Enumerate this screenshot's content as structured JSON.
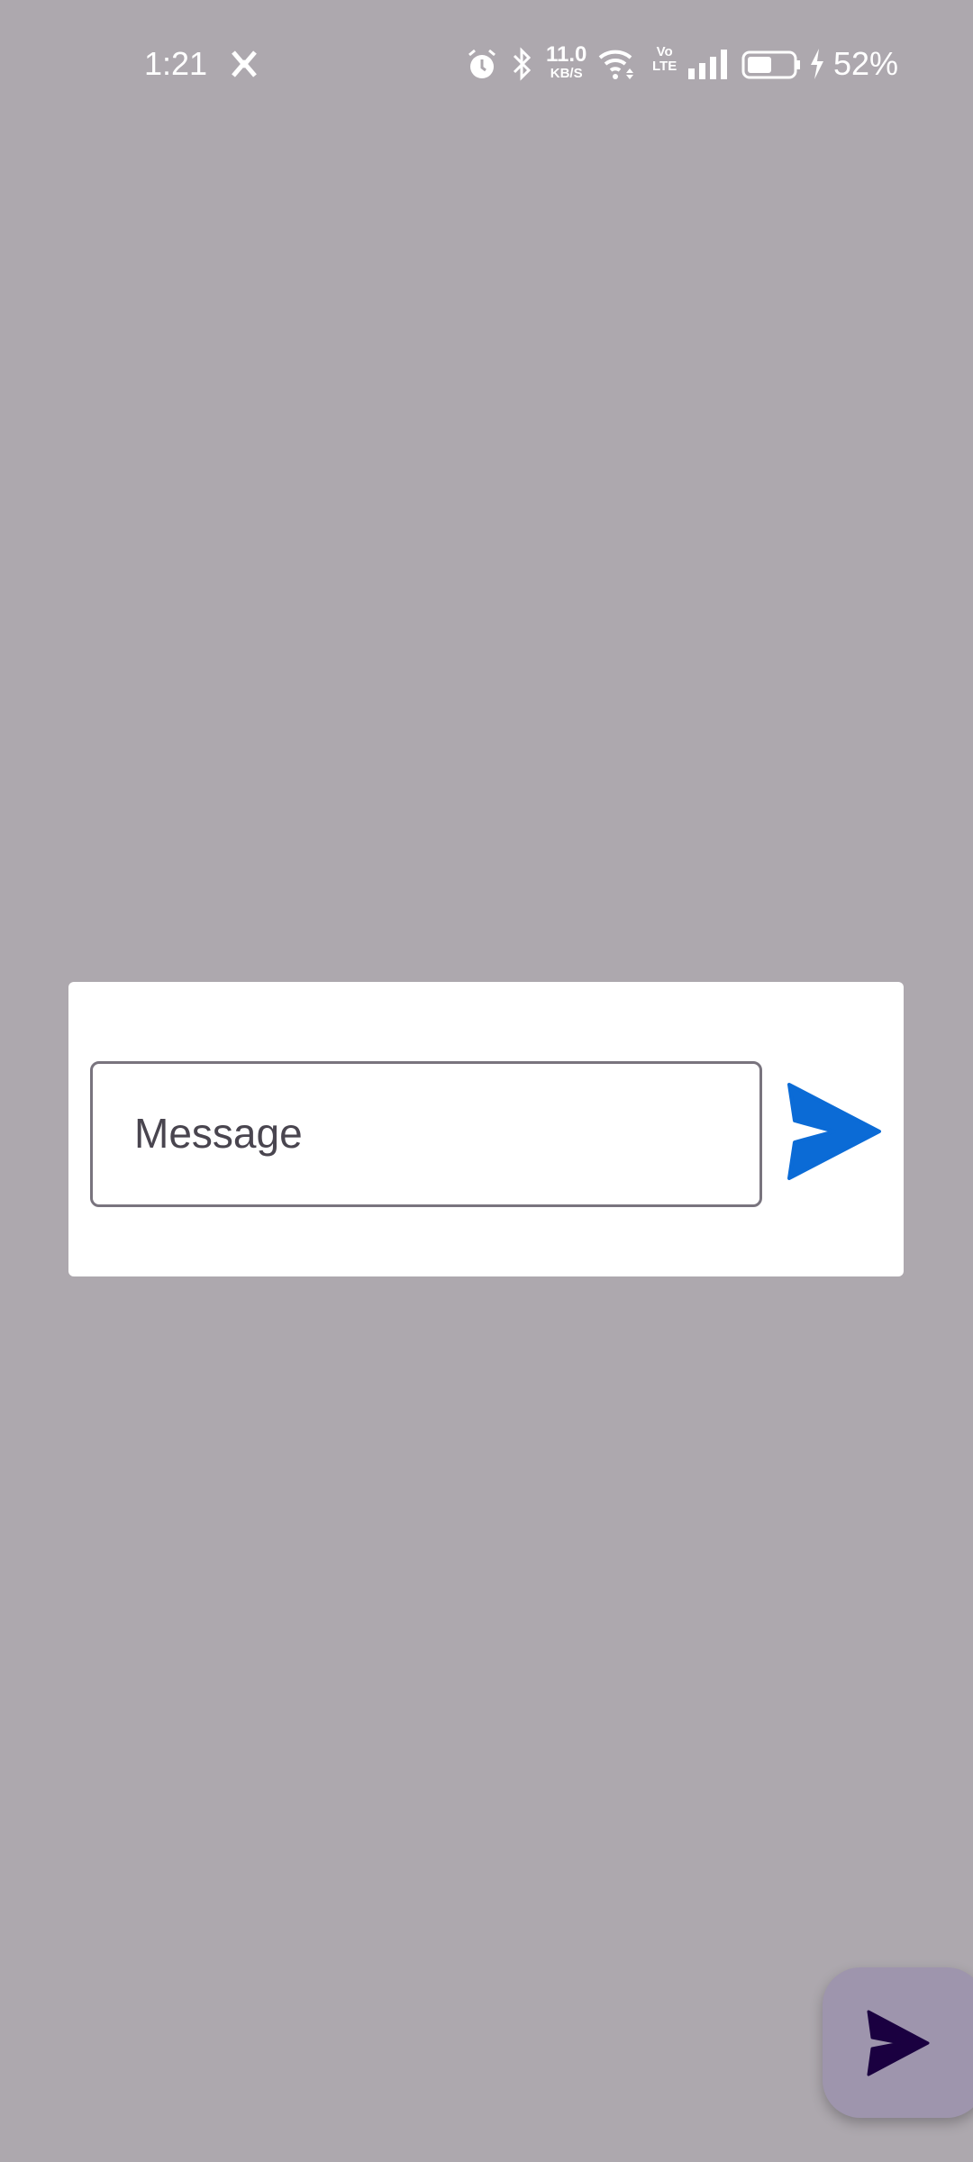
{
  "status_bar": {
    "time": "1:21",
    "net_speed_value": "11.0",
    "net_speed_unit": "KB/S",
    "volte": "Vo",
    "lte": "LTE",
    "battery_percent": "52%",
    "battery_level": 0.52
  },
  "dialog": {
    "message_input": {
      "value": "",
      "placeholder": "Message"
    },
    "send_icon": "send-icon",
    "send_color": "#0b6bd6"
  },
  "fab": {
    "icon": "send-icon",
    "color": "#1a0040"
  }
}
